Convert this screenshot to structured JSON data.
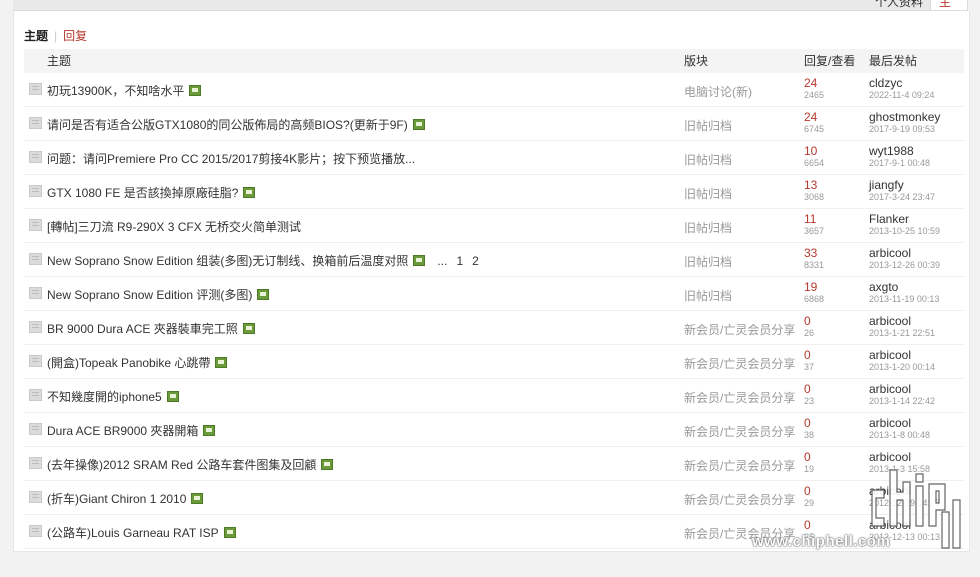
{
  "top_tabs": {
    "profile": "个人资料",
    "topics": "主题"
  },
  "subnav": {
    "current": "主题",
    "other": "回复"
  },
  "columns": {
    "subject": "主题",
    "forum": "版块",
    "stats": "回复/查看",
    "last": "最后发帖"
  },
  "threads": [
    {
      "title": "初玩13900K，不知啥水平",
      "forum": "电脑讨论(新)",
      "replies": "24",
      "views": "2465",
      "author": "cldzyc",
      "time": "2022-11-4 09:24",
      "attach": true
    },
    {
      "title": "请问是否有适合公版GTX1080的同公版佈局的高频BIOS?(更新于9F)",
      "forum": "旧帖归档",
      "replies": "24",
      "views": "6745",
      "author": "ghostmonkey",
      "time": "2017-9-19 09:53",
      "attach": true
    },
    {
      "title": "问题：请问Premiere Pro CC 2015/2017剪接4K影片；按下预览播放...",
      "forum": "旧帖归档",
      "replies": "10",
      "views": "6654",
      "author": "wyt1988",
      "time": "2017-9-1 00:48",
      "attach": false
    },
    {
      "title": "GTX 1080 FE 是否該換掉原廠硅脂?",
      "forum": "旧帖归档",
      "replies": "13",
      "views": "3068",
      "author": "jiangfy",
      "time": "2017-3-24 23:47",
      "attach": true
    },
    {
      "title": "[轉帖]三刀流 R9-290X 3 CFX 无桥交火简单测试",
      "forum": "旧帖归档",
      "replies": "11",
      "views": "3657",
      "author": "Flanker",
      "time": "2013-10-25 10:59",
      "attach": false
    },
    {
      "title": "New Soprano Snow Edition 组装(多图)无订制线、换箱前后温度对照",
      "forum": "旧帖归档",
      "replies": "33",
      "views": "8331",
      "author": "arbicool",
      "time": "2013-12-26 00:39",
      "attach": true,
      "pages": [
        "...",
        "1",
        "2"
      ]
    },
    {
      "title": "New Soprano Snow Edition 评测(多图)",
      "forum": "旧帖归档",
      "replies": "19",
      "views": "6868",
      "author": "axgto",
      "time": "2013-11-19 00:13",
      "attach": true
    },
    {
      "title": "BR 9000 Dura ACE 夾器裝車完工照",
      "forum": "新会员/亡灵会员分享",
      "replies": "0",
      "views": "26",
      "author": "arbicool",
      "time": "2013-1-21 22:51",
      "attach": true
    },
    {
      "title": "(開盒)Topeak Panobike 心跳帶",
      "forum": "新会员/亡灵会员分享",
      "replies": "0",
      "views": "37",
      "author": "arbicool",
      "time": "2013-1-20 00:14",
      "attach": true
    },
    {
      "title": "不知幾度開的iphone5",
      "forum": "新会员/亡灵会员分享",
      "replies": "0",
      "views": "23",
      "author": "arbicool",
      "time": "2013-1-14 22:42",
      "attach": true
    },
    {
      "title": "Dura ACE BR9000 夾器開箱",
      "forum": "新会员/亡灵会员分享",
      "replies": "0",
      "views": "38",
      "author": "arbicool",
      "time": "2013-1-8 00:48",
      "attach": true
    },
    {
      "title": "(去年操像)2012 SRAM Red 公路车套件图集及回顧",
      "forum": "新会员/亡灵会员分享",
      "replies": "0",
      "views": "19",
      "author": "arbicool",
      "time": "2013-1-3 15:58",
      "attach": true
    },
    {
      "title": "(折车)Giant Chiron 1 2010",
      "forum": "新会员/亡灵会员分享",
      "replies": "0",
      "views": "29",
      "author": "arbicool",
      "time": "2012-12-19 14:03",
      "attach": true
    },
    {
      "title": "(公路车)Louis Garneau RAT ISP",
      "forum": "新会员/亡灵会员分享",
      "replies": "0",
      "views": "25",
      "author": "arbicool",
      "time": "2012-12-13 00:13",
      "attach": true
    }
  ],
  "watermark": {
    "url": "www.chiphell.com"
  }
}
